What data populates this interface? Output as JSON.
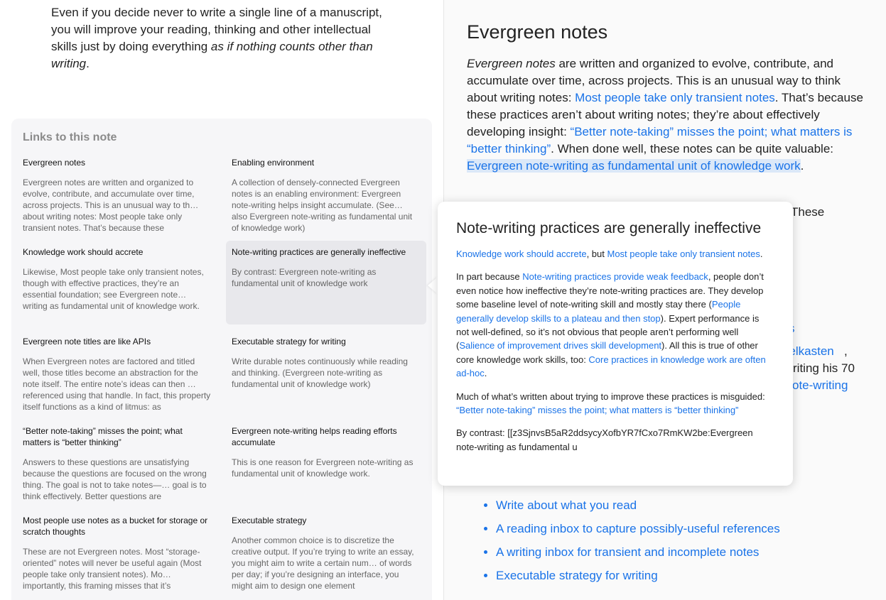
{
  "intro": {
    "text_plain": "Even if you decide never to write a single line of a manuscript, you will improve your reading, thinking and other intellectual skills just by doing everything ",
    "text_em": "as if nothing counts other than writing",
    "text_end": "."
  },
  "backlinks": {
    "heading": "Links to this note",
    "cards": [
      {
        "title": "Evergreen notes",
        "excerpt": "Evergreen notes are written and organized to evolve, contribute, and accumulate over time, across projects. This is an unusual way to th… about writing notes: Most people take only transient notes. That’s because these"
      },
      {
        "title": "Enabling environment",
        "excerpt": "A collection of densely-connected Evergreen notes is an enabling environment: Evergreen note-writing helps insight accumulate. (See… also Evergreen note-writing as fundamental unit of knowledge work)"
      },
      {
        "title": "Knowledge work should accrete",
        "excerpt": "Likewise, Most people take only transient notes, though with effective practices, they’re an essential foundation; see Evergreen note… writing as fundamental unit of knowledge work."
      },
      {
        "title": "Note-writing practices are generally ineffective",
        "excerpt": "By contrast: Evergreen note-writing as fundamental unit of knowledge work"
      },
      {
        "title": "Evergreen note titles are like APIs",
        "excerpt": "When Evergreen notes are factored and titled well, those titles become an abstraction for the note itself. The entire note’s ideas can then … referenced using that handle. In fact, this property itself functions as a kind of litmus: as"
      },
      {
        "title": "Executable strategy for writing",
        "excerpt": "Write durable notes continuously while reading and thinking. (Evergreen note-writing as fundamental unit of knowledge work)"
      },
      {
        "title": "“Better note-taking” misses the point; what matters is “better thinking”",
        "excerpt": "Answers to these questions are unsatisfying because the questions are focused on the wrong thing. The goal is not to take notes—… goal is to think effectively. Better questions are"
      },
      {
        "title": "Evergreen note-writing helps reading efforts accumulate",
        "excerpt": "This is one reason for Evergreen note-writing as fundamental unit of knowledge work."
      },
      {
        "title": "Most people use notes as a bucket for storage or scratch thoughts",
        "excerpt": "These are not Evergreen notes. Most “storage-oriented” notes will never be useful again (Most people take only transient notes). Mo… importantly, this framing misses that it’s"
      },
      {
        "title": "Executable strategy",
        "excerpt": "Another common choice is to discretize the creative output. If you’re trying to write an essay, you might aim to write a certain num… of words per day; if you’re designing an interface, you might aim to design one element"
      }
    ]
  },
  "note": {
    "title": "Evergreen notes",
    "p1_em": "Evergreen notes",
    "p1_a": " are written and organized to evolve, contribute, and accumulate over time, across projects. This is an unusual way to think about writing notes: ",
    "p1_link1": "Most people take only transient notes",
    "p1_b": ". That’s because these practices aren’t about writing notes; they’re about effectively developing insight: ",
    "p1_link2": "“Better note-taking” misses the point; what matters is “better thinking”",
    "p1_c": ". When done well, these notes can be quite valuable: ",
    "p1_link3": "Evergreen note-writing as fundamental unit of knowledge work",
    "p1_d": ".",
    "partial_these": "These",
    "partial_s": "s",
    "partial_ttelkasten": "ttelkasten",
    "partial_comma": ",",
    "partial_writing70": "riting his 70",
    "partial_otewriting": "ote-writing",
    "list": [
      "Write about what you read",
      "A reading inbox to capture possibly-useful references",
      "A writing inbox for transient and incomplete notes",
      "Executable strategy for writing"
    ]
  },
  "popover": {
    "title": "Note-writing practices are generally ineffective",
    "p1_link1": "Knowledge work should accrete",
    "p1_mid": ", but ",
    "p1_link2": "Most people take only transient notes",
    "p1_end": ".",
    "p2_a": "In part because ",
    "p2_link1": "Note-writing practices provide weak feedback",
    "p2_b": ", people don’t even notice how ineffective they’re note-writing practices are. They develop some baseline level of note-writing skill and mostly stay there (",
    "p2_link2": "People generally develop skills to a plateau and then stop",
    "p2_c": "). Expert performance is not well-defined, so it’s not obvious that people aren’t performing well (",
    "p2_link3": "Salience of improvement drives skill development",
    "p2_d": "). All this is true of other core knowledge work skills, too: ",
    "p2_link4": "Core practices in knowledge work are often ad-hoc",
    "p2_e": ".",
    "p3_a": "Much of what’s written about trying to improve these practices is misguided: ",
    "p3_link": "“Better note-taking” misses the point; what matters is “better thinking”",
    "p4": "By contrast: [[z3SjnvsB5aR2ddsycyXofbYR7fCxo7RmKW2be:Evergreen note-writing as fundamental u"
  },
  "colors": {
    "link": "#1a73e8",
    "selection": "#dbe8f8",
    "panel_bg": "#f6f6f8",
    "highlight_card": "#e8e8ec"
  }
}
